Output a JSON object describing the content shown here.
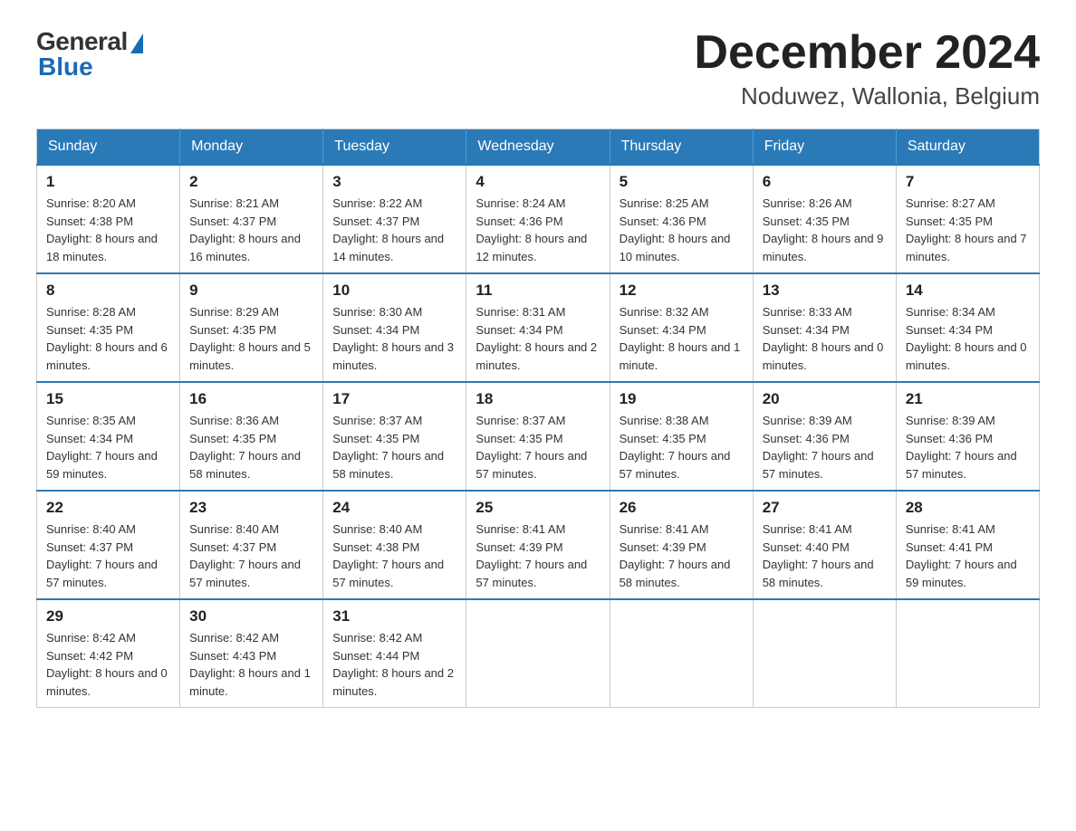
{
  "header": {
    "logo_general": "General",
    "logo_blue": "Blue",
    "month_title": "December 2024",
    "location": "Noduwez, Wallonia, Belgium"
  },
  "weekdays": [
    "Sunday",
    "Monday",
    "Tuesday",
    "Wednesday",
    "Thursday",
    "Friday",
    "Saturday"
  ],
  "weeks": [
    [
      {
        "day": "1",
        "sunrise": "8:20 AM",
        "sunset": "4:38 PM",
        "daylight": "8 hours and 18 minutes."
      },
      {
        "day": "2",
        "sunrise": "8:21 AM",
        "sunset": "4:37 PM",
        "daylight": "8 hours and 16 minutes."
      },
      {
        "day": "3",
        "sunrise": "8:22 AM",
        "sunset": "4:37 PM",
        "daylight": "8 hours and 14 minutes."
      },
      {
        "day": "4",
        "sunrise": "8:24 AM",
        "sunset": "4:36 PM",
        "daylight": "8 hours and 12 minutes."
      },
      {
        "day": "5",
        "sunrise": "8:25 AM",
        "sunset": "4:36 PM",
        "daylight": "8 hours and 10 minutes."
      },
      {
        "day": "6",
        "sunrise": "8:26 AM",
        "sunset": "4:35 PM",
        "daylight": "8 hours and 9 minutes."
      },
      {
        "day": "7",
        "sunrise": "8:27 AM",
        "sunset": "4:35 PM",
        "daylight": "8 hours and 7 minutes."
      }
    ],
    [
      {
        "day": "8",
        "sunrise": "8:28 AM",
        "sunset": "4:35 PM",
        "daylight": "8 hours and 6 minutes."
      },
      {
        "day": "9",
        "sunrise": "8:29 AM",
        "sunset": "4:35 PM",
        "daylight": "8 hours and 5 minutes."
      },
      {
        "day": "10",
        "sunrise": "8:30 AM",
        "sunset": "4:34 PM",
        "daylight": "8 hours and 3 minutes."
      },
      {
        "day": "11",
        "sunrise": "8:31 AM",
        "sunset": "4:34 PM",
        "daylight": "8 hours and 2 minutes."
      },
      {
        "day": "12",
        "sunrise": "8:32 AM",
        "sunset": "4:34 PM",
        "daylight": "8 hours and 1 minute."
      },
      {
        "day": "13",
        "sunrise": "8:33 AM",
        "sunset": "4:34 PM",
        "daylight": "8 hours and 0 minutes."
      },
      {
        "day": "14",
        "sunrise": "8:34 AM",
        "sunset": "4:34 PM",
        "daylight": "8 hours and 0 minutes."
      }
    ],
    [
      {
        "day": "15",
        "sunrise": "8:35 AM",
        "sunset": "4:34 PM",
        "daylight": "7 hours and 59 minutes."
      },
      {
        "day": "16",
        "sunrise": "8:36 AM",
        "sunset": "4:35 PM",
        "daylight": "7 hours and 58 minutes."
      },
      {
        "day": "17",
        "sunrise": "8:37 AM",
        "sunset": "4:35 PM",
        "daylight": "7 hours and 58 minutes."
      },
      {
        "day": "18",
        "sunrise": "8:37 AM",
        "sunset": "4:35 PM",
        "daylight": "7 hours and 57 minutes."
      },
      {
        "day": "19",
        "sunrise": "8:38 AM",
        "sunset": "4:35 PM",
        "daylight": "7 hours and 57 minutes."
      },
      {
        "day": "20",
        "sunrise": "8:39 AM",
        "sunset": "4:36 PM",
        "daylight": "7 hours and 57 minutes."
      },
      {
        "day": "21",
        "sunrise": "8:39 AM",
        "sunset": "4:36 PM",
        "daylight": "7 hours and 57 minutes."
      }
    ],
    [
      {
        "day": "22",
        "sunrise": "8:40 AM",
        "sunset": "4:37 PM",
        "daylight": "7 hours and 57 minutes."
      },
      {
        "day": "23",
        "sunrise": "8:40 AM",
        "sunset": "4:37 PM",
        "daylight": "7 hours and 57 minutes."
      },
      {
        "day": "24",
        "sunrise": "8:40 AM",
        "sunset": "4:38 PM",
        "daylight": "7 hours and 57 minutes."
      },
      {
        "day": "25",
        "sunrise": "8:41 AM",
        "sunset": "4:39 PM",
        "daylight": "7 hours and 57 minutes."
      },
      {
        "day": "26",
        "sunrise": "8:41 AM",
        "sunset": "4:39 PM",
        "daylight": "7 hours and 58 minutes."
      },
      {
        "day": "27",
        "sunrise": "8:41 AM",
        "sunset": "4:40 PM",
        "daylight": "7 hours and 58 minutes."
      },
      {
        "day": "28",
        "sunrise": "8:41 AM",
        "sunset": "4:41 PM",
        "daylight": "7 hours and 59 minutes."
      }
    ],
    [
      {
        "day": "29",
        "sunrise": "8:42 AM",
        "sunset": "4:42 PM",
        "daylight": "8 hours and 0 minutes."
      },
      {
        "day": "30",
        "sunrise": "8:42 AM",
        "sunset": "4:43 PM",
        "daylight": "8 hours and 1 minute."
      },
      {
        "day": "31",
        "sunrise": "8:42 AM",
        "sunset": "4:44 PM",
        "daylight": "8 hours and 2 minutes."
      },
      null,
      null,
      null,
      null
    ]
  ]
}
